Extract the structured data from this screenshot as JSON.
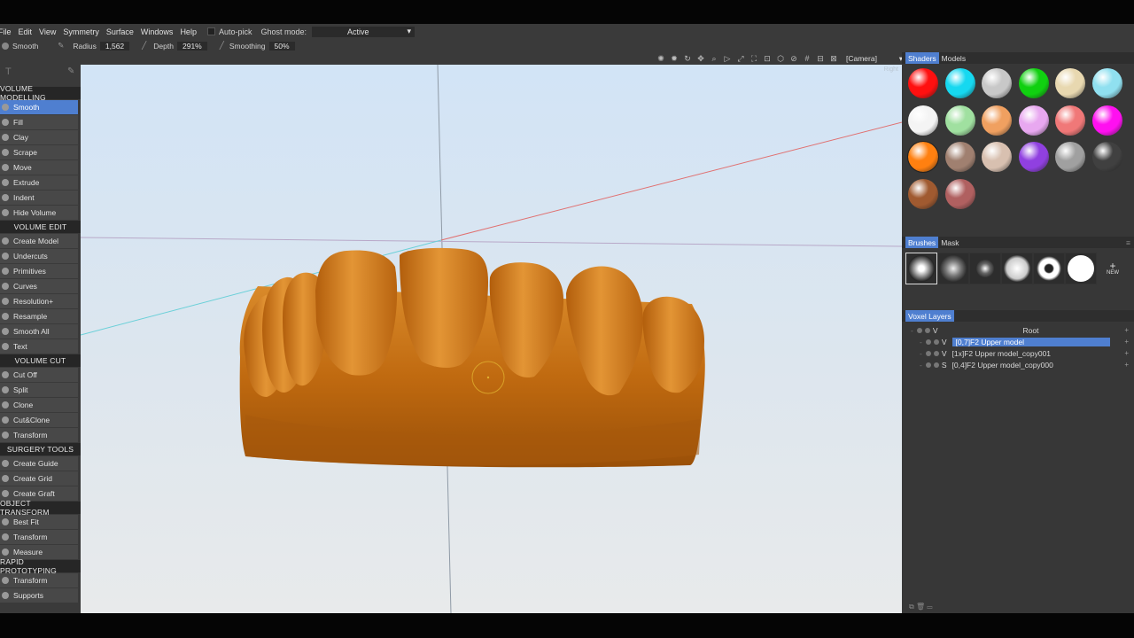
{
  "menu": {
    "items": [
      "File",
      "Edit",
      "View",
      "Symmetry",
      "Surface",
      "Windows",
      "Help"
    ],
    "auto_pick": "Auto-pick",
    "ghost_mode_label": "Ghost mode:",
    "ghost_mode_value": "Active"
  },
  "tool_options": {
    "tool": "Smooth",
    "radius_label": "Radius",
    "radius_value": "1,562",
    "depth_label": "Depth",
    "depth_value": "291%",
    "smoothing_label": "Smoothing",
    "smoothing_value": "50%"
  },
  "camera": {
    "label": "[Camera]"
  },
  "viewport": {
    "corner_label": "Right"
  },
  "left_panel": {
    "sections": [
      {
        "title": "VOLUME MODELLING",
        "items": [
          "Smooth",
          "Fill",
          "Clay",
          "Scrape",
          "Move",
          "Extrude",
          "Indent",
          "Hide Volume"
        ]
      },
      {
        "title": "VOLUME EDIT",
        "items": [
          "Create Model",
          "Undercuts",
          "Primitives",
          "Curves",
          "Resolution+",
          "Resample",
          "Smooth All",
          "Text"
        ]
      },
      {
        "title": "VOLUME CUT",
        "items": [
          "Cut Off",
          "Split",
          "Clone",
          "Cut&Clone",
          "Transform"
        ]
      },
      {
        "title": "SURGERY TOOLS",
        "items": [
          "Create Guide",
          "Create Grid",
          "Create Graft"
        ]
      },
      {
        "title": "OBJECT TRANSFORM",
        "items": [
          "Best Fit",
          "Transform",
          "Measure"
        ]
      },
      {
        "title": "RAPID PROTOTYPING",
        "items": [
          "Transform",
          "Supports"
        ]
      }
    ],
    "selected": "Smooth"
  },
  "right_panel": {
    "shader_tabs": [
      "Shaders",
      "Models"
    ],
    "shader_colors": [
      "#ff1010",
      "#16d8f0",
      "#c8c8c8",
      "#10d010",
      "#e8d8b0",
      "#90e0f0",
      "#f4f4f4",
      "#a0e0a0",
      "#f0a060",
      "#e8a8f0",
      "#f07878",
      "#ff10f0",
      "#ff8010",
      "#a08070",
      "#d8c0b0",
      "#9040e0",
      "#a0a0a0",
      "#404040",
      "#a05a30",
      "#b06060"
    ],
    "brush_tabs": [
      "Brushes",
      "Mask"
    ],
    "brush_new_label": "NEW",
    "layers_tab": "Voxel Layers",
    "layers": [
      {
        "flag": "V",
        "name": "Root"
      },
      {
        "flag": "V",
        "name": "[0,7]F2 Upper model"
      },
      {
        "flag": "V",
        "name": "[1x]F2 Upper model_copy001"
      },
      {
        "flag": "S",
        "name": "[0,4]F2 Upper model_copy000"
      }
    ],
    "selected_layer": "[0,7]F2 Upper model"
  },
  "colors": {
    "accent": "#4f7fd0",
    "model": "#c06a10"
  }
}
